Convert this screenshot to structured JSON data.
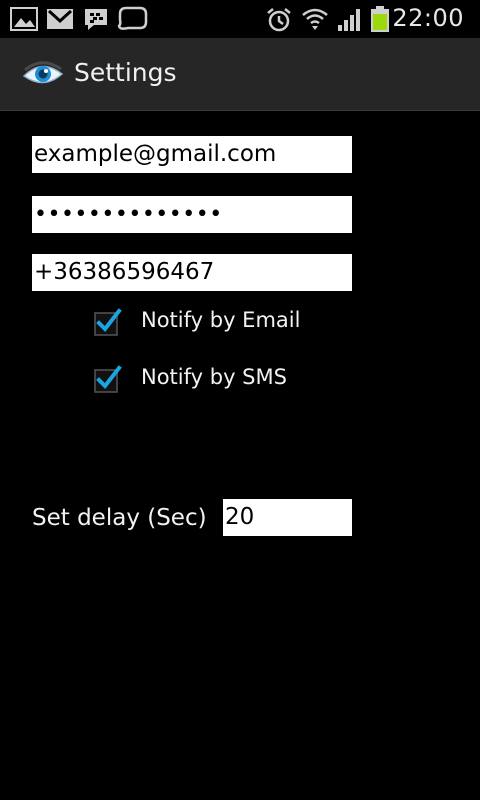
{
  "status_bar": {
    "time": "22:00",
    "icons": [
      "gallery-icon",
      "gmail-icon",
      "bbm-icon",
      "chat-bubble-icon",
      "alarm-icon",
      "wifi-icon",
      "signal-icon",
      "battery-icon"
    ],
    "battery_color": "#9bd90d"
  },
  "action_bar": {
    "title": "Settings",
    "icon": "eye-icon"
  },
  "form": {
    "email_value": "example@gmail.com",
    "password_value": "••••••••••••••",
    "phone_value": "+36386596467",
    "notify_email": {
      "label": "Notify by Email",
      "checked": true
    },
    "notify_sms": {
      "label": "Notify by SMS",
      "checked": true
    },
    "delay_label": "Set delay (Sec)",
    "delay_value": "20"
  },
  "colors": {
    "background": "#000000",
    "action_bar": "#262626",
    "check_accent": "#1aa6e0"
  }
}
